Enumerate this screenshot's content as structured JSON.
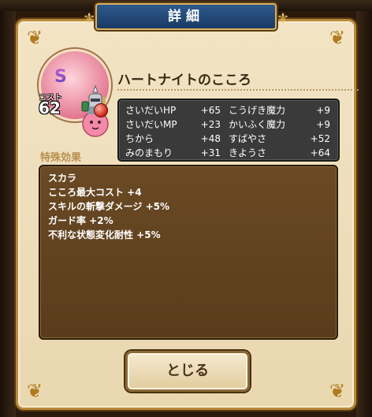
{
  "header": {
    "title": "詳細"
  },
  "monster": {
    "rank": "S",
    "cost_label": "コスト",
    "cost_value": "62",
    "heart_name": "ハートナイトのこころ"
  },
  "stats": [
    [
      {
        "name": "さいだいHP",
        "value": "+65"
      },
      {
        "name": "こうげき魔力",
        "value": "+9"
      }
    ],
    [
      {
        "name": "さいだいMP",
        "value": "+23"
      },
      {
        "name": "かいふく魔力",
        "value": "+9"
      }
    ],
    [
      {
        "name": "ちから",
        "value": "+48"
      },
      {
        "name": "すばやさ",
        "value": "+52"
      }
    ],
    [
      {
        "name": "みのまもり",
        "value": "+31"
      },
      {
        "name": "きようさ",
        "value": "+64"
      }
    ]
  ],
  "special": {
    "label": "特殊効果",
    "effects": [
      "スカラ",
      "こころ最大コスト +4",
      "スキルの斬撃ダメージ +5%",
      "ガード率 +2%",
      "不利な状態変化耐性 +5%"
    ]
  },
  "close_button": {
    "label": "とじる"
  },
  "colors": {
    "banner": "#1a3a64",
    "panel": "#f2e4c4",
    "stats_bg": "#3a3a3a",
    "effects_bg": "#5a3c1c",
    "border_gold": "#b88a3a"
  }
}
